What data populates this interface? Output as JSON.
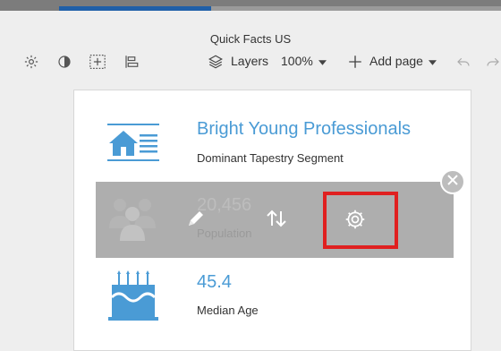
{
  "header": {
    "title": "Quick Facts US"
  },
  "toolbar": {
    "layers_label": "Layers",
    "zoom_label": "100%",
    "add_page_label": "Add page"
  },
  "infographic": {
    "title": "Bright Young Professionals",
    "subtitle": "Dominant Tapestry Segment",
    "population_value": "20,456",
    "population_label": "Population",
    "median_age_value": "45.4",
    "median_age_label": "Median Age"
  },
  "colors": {
    "accent_blue": "#4a9bd5",
    "highlight_red": "#e02020",
    "overlay_gray": "#a0a0a0"
  },
  "icons": {
    "toolbar": [
      "gear-icon",
      "contrast-icon",
      "select-area-icon",
      "align-icon",
      "layers-icon",
      "plus-icon",
      "undo-icon",
      "redo-icon"
    ],
    "overlay_actions": [
      "pencil-icon",
      "swap-icon",
      "gear-icon",
      "close-icon"
    ]
  }
}
